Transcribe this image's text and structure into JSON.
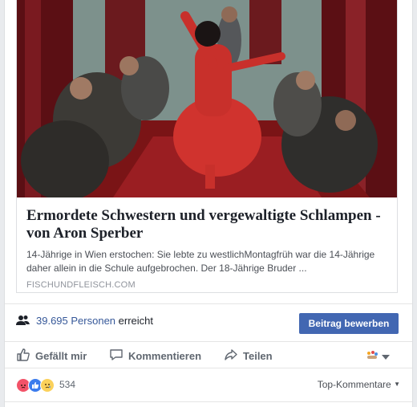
{
  "card": {
    "title": "Ermordete Schwestern und vergewaltigte Schlampen - von Aron Sperber",
    "description": "14-Jährige in Wien erstochen: Sie lebte zu westlichMontagfrüh war die 14-Jährige daher allein in die Schule aufgebrochen. Der 18-Jährige Bruder ...",
    "domain": "FISCHUNDFLEISCH.COM"
  },
  "reach": {
    "count": "39.695",
    "people_label": "Personen",
    "reached_label": "erreicht",
    "promote_label": "Beitrag bewerben"
  },
  "actions": {
    "like": "Gefällt mir",
    "comment": "Kommentieren",
    "share": "Teilen"
  },
  "reactions": {
    "count": "534",
    "sort_label": "Top-Kommentare"
  },
  "colors": {
    "link_blue": "#365899",
    "button_blue": "#4267b2",
    "gray_text": "#606770"
  }
}
